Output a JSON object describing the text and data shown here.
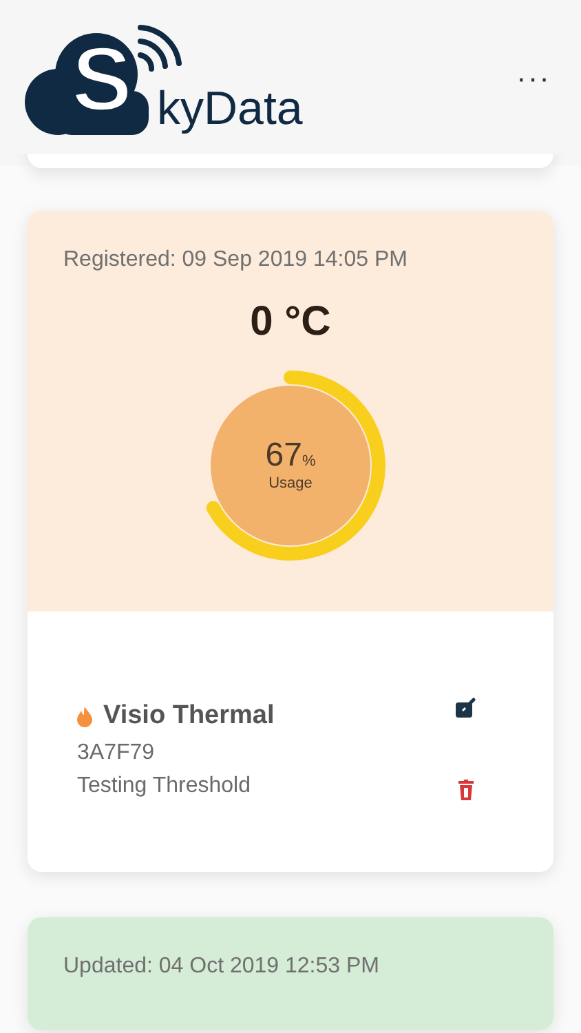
{
  "header": {
    "brand_initial": "S",
    "brand_rest": "kyData",
    "menu": "···"
  },
  "devices": [
    {
      "color": "#fdebdc",
      "stamp": "Registered: 09 Sep 2019 14:05 PM",
      "temperature": "0 °C",
      "usage": {
        "value": "67",
        "unit": "%",
        "label": "Usage",
        "level": 0.67
      },
      "name": "Visio Thermal",
      "code": "3A7F79",
      "description": "Testing Threshold"
    },
    {
      "color": "#d5ecd6",
      "stamp": "Updated: 04 Oct 2019 12:53 PM"
    }
  ]
}
